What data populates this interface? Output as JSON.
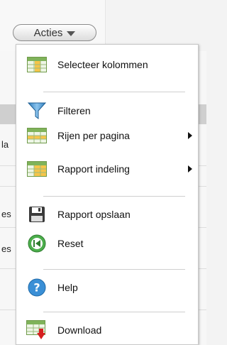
{
  "actions_button": {
    "label": "Acties"
  },
  "background": {
    "fragments": [
      {
        "text": "la"
      },
      {
        "text": "es"
      },
      {
        "text": "es"
      }
    ]
  },
  "menu": {
    "items": [
      {
        "label": "Selecteer kolommen",
        "icon": "table-columns-icon"
      },
      {
        "label": "Filteren",
        "icon": "funnel-icon"
      },
      {
        "label": "Rijen per pagina",
        "icon": "table-rows-icon",
        "submenu": true
      },
      {
        "label": "Rapport indeling",
        "icon": "table-layout-icon",
        "submenu": true
      },
      {
        "label": "Rapport opslaan",
        "icon": "floppy-disk-icon"
      },
      {
        "label": "Reset",
        "icon": "reset-icon"
      },
      {
        "label": "Help",
        "icon": "help-icon"
      },
      {
        "label": "Download",
        "icon": "table-download-icon"
      }
    ]
  }
}
